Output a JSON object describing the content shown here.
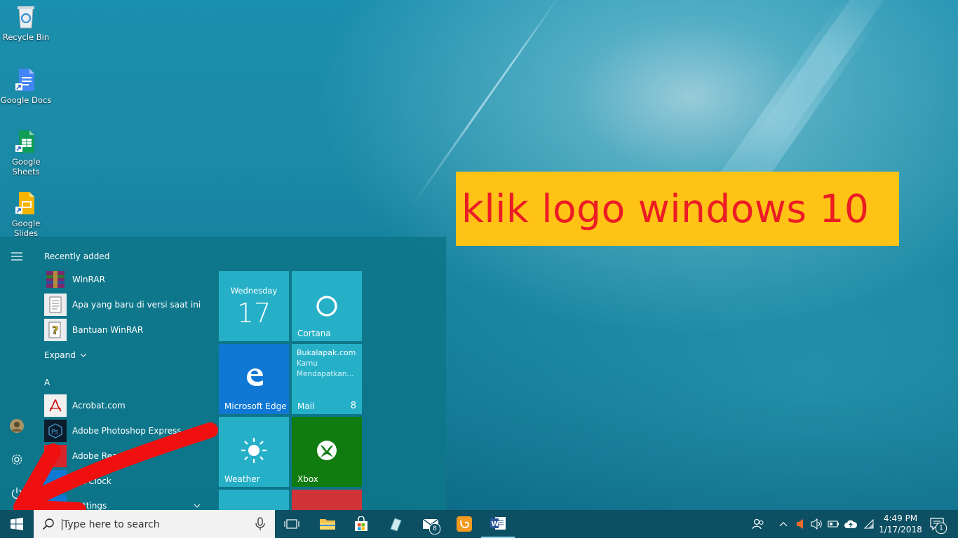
{
  "desktop": {
    "icons": [
      {
        "label": "Recycle Bin",
        "icon": "recycle-bin-icon"
      },
      {
        "label": "Google Docs",
        "icon": "google-docs-icon"
      },
      {
        "label": "Google Sheets",
        "icon": "google-sheets-icon"
      },
      {
        "label": "Google Slides",
        "icon": "google-slides-icon"
      }
    ]
  },
  "banner": {
    "text": "klik logo windows 10",
    "bg_color": "#ffc316",
    "text_color": "#ec1c24"
  },
  "start_menu": {
    "recently_added_header": "Recently added",
    "recent_apps": [
      {
        "label": "WinRAR",
        "icon": "winrar-icon"
      },
      {
        "label": "Apa yang baru di versi saat ini",
        "icon": "document-icon"
      },
      {
        "label": "Bantuan WinRAR",
        "icon": "help-file-icon"
      }
    ],
    "expand_label": "Expand",
    "section_letter": "A",
    "apps": [
      {
        "label": "Acrobat.com",
        "icon": "acrobat-icon"
      },
      {
        "label": "Adobe Photoshop Express",
        "icon": "photoshop-express-icon"
      },
      {
        "label": "Adobe Read",
        "icon": "adobe-reader-icon"
      },
      {
        "label": "s & Clock",
        "icon": "clock-icon"
      },
      {
        "label": "Settings",
        "icon": "settings-app-icon"
      }
    ],
    "tiles": {
      "calendar": {
        "day": "Wednesday",
        "date": "17"
      },
      "cortana": {
        "label": "Cortana"
      },
      "edge": {
        "label": "Microsoft Edge"
      },
      "mail": {
        "title": "Bukalapak.com",
        "line1": "Kamu",
        "line2": "Mendapatkan...",
        "label": "Mail",
        "count": "8"
      },
      "weather": {
        "label": "Weather"
      },
      "xbox": {
        "label": "Xbox"
      }
    },
    "accent_colors": {
      "tile": "#26b0c8",
      "edge": "#0f78d4",
      "xbox": "#107c10",
      "red_tile": "#d13438"
    }
  },
  "taskbar": {
    "search_placeholder": "Type here to search",
    "mail_badge": "8",
    "clock_time": "4:49 PM",
    "clock_date": "1/17/2018",
    "notification_count": "1"
  }
}
